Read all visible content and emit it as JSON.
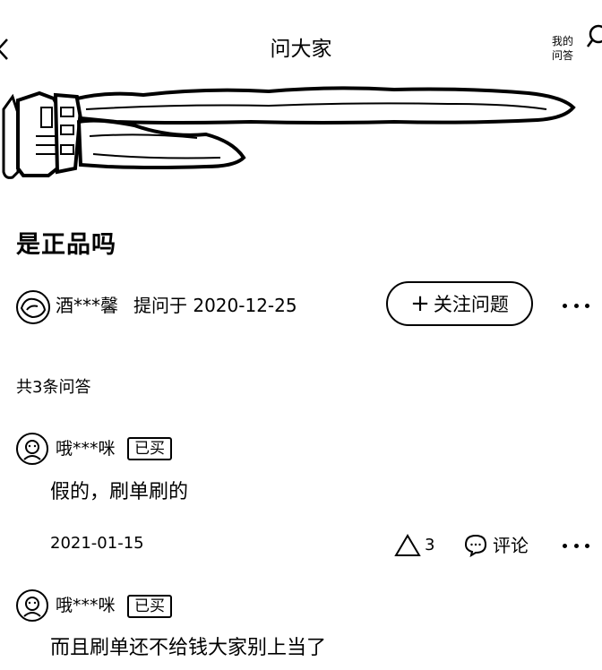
{
  "header": {
    "title": "问大家",
    "my_qa_line1": "我的",
    "my_qa_line2": "问答"
  },
  "question": {
    "title": "是正品吗",
    "asker_name": "酒***馨",
    "asked_on": "提问于 2020-12-25",
    "follow_label": "关注问题"
  },
  "answers_summary": "共3条问答",
  "answers": [
    {
      "user": "哦***咪",
      "badge": "已买",
      "text": "假的，刷单刷的",
      "date": "2021-01-15",
      "likes": "3",
      "comment_label": "评论"
    },
    {
      "user": "哦***咪",
      "badge": "已买",
      "text": "而且刷单还不给钱大家别上当了"
    }
  ],
  "icons": {
    "back": "chevron-left-icon",
    "search": "search-icon",
    "more": "more-dots-icon",
    "like": "triangle-like-icon",
    "comment": "speech-bubble-icon",
    "plus": "plus-icon"
  },
  "colors": {
    "background": "#ffffff",
    "text": "#000000"
  }
}
